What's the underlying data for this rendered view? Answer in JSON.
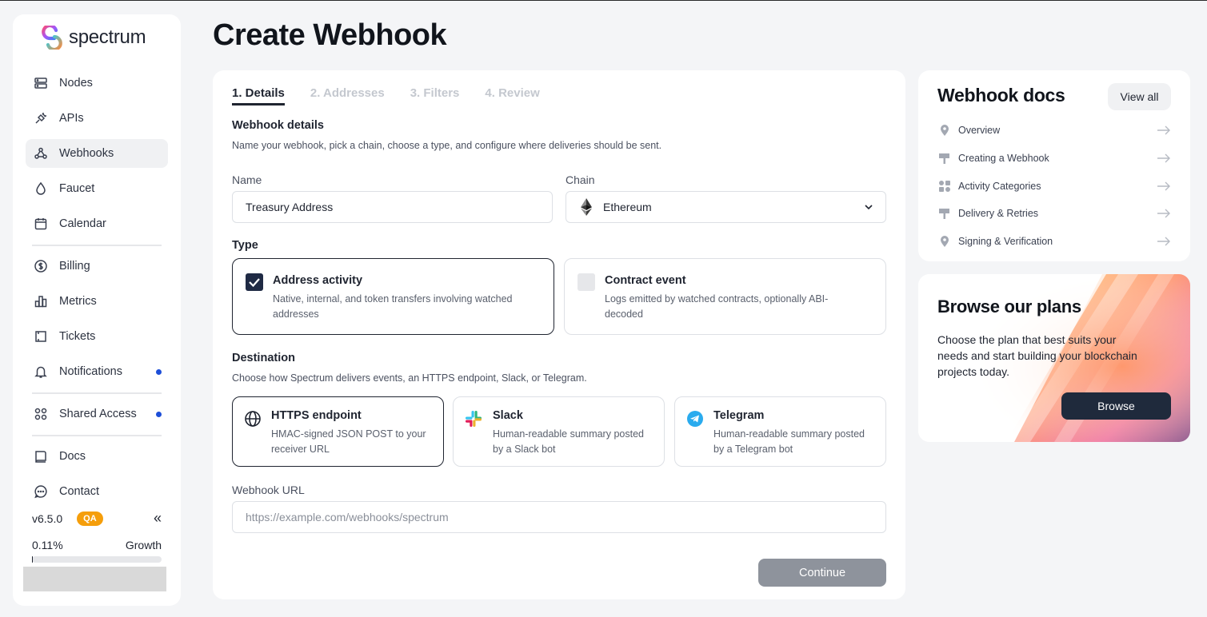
{
  "app": {
    "logo_text": "spectrum"
  },
  "sidebar": {
    "items": [
      {
        "label": "Nodes",
        "icon": "server-icon"
      },
      {
        "label": "APIs",
        "icon": "plug-icon"
      },
      {
        "label": "Webhooks",
        "icon": "webhook-icon",
        "active": true
      },
      {
        "label": "Faucet",
        "icon": "droplet-icon"
      },
      {
        "label": "Calendar",
        "icon": "calendar-icon"
      },
      {
        "label": "Billing",
        "icon": "dollar-icon"
      },
      {
        "label": "Metrics",
        "icon": "bar-chart-icon"
      },
      {
        "label": "Tickets",
        "icon": "ticket-icon"
      },
      {
        "label": "Notifications",
        "icon": "bell-icon",
        "dot": true
      },
      {
        "label": "Shared Access",
        "icon": "grid-circles-icon",
        "dot": true
      },
      {
        "label": "Docs",
        "icon": "book-icon"
      },
      {
        "label": "Contact",
        "icon": "chat-icon"
      }
    ],
    "version": "v6.5.0",
    "env_badge": "QA",
    "collapse_glyph": "«",
    "usage_percent": "0.11%",
    "usage_fraction": 0.0011,
    "plan_label": "Growth"
  },
  "page": {
    "title": "Create Webhook"
  },
  "steps": [
    "1. Details",
    "2. Addresses",
    "3. Filters",
    "4. Review"
  ],
  "details": {
    "title": "Webhook details",
    "subtitle": "Name your webhook, pick a chain, choose a type, and configure where deliveries should be sent.",
    "name_label": "Name",
    "name_value": "Treasury Address",
    "chain_label": "Chain",
    "chain_value": "Ethereum"
  },
  "type": {
    "title": "Type",
    "options": [
      {
        "title": "Address activity",
        "desc": "Native, internal, and token transfers involving watched addresses",
        "selected": true
      },
      {
        "title": "Contract event",
        "desc": "Logs emitted by watched contracts, optionally ABI-decoded",
        "selected": false
      }
    ]
  },
  "destination": {
    "title": "Destination",
    "subtitle": "Choose how Spectrum delivers events, an HTTPS endpoint, Slack, or Telegram.",
    "options": [
      {
        "title": "HTTPS endpoint",
        "desc": "HMAC-signed JSON POST to your receiver URL",
        "icon": "globe-icon",
        "selected": true
      },
      {
        "title": "Slack",
        "desc": "Human-readable summary posted by a Slack bot",
        "icon": "slack-icon",
        "selected": false
      },
      {
        "title": "Telegram",
        "desc": "Human-readable summary posted by a Telegram bot",
        "icon": "telegram-icon",
        "selected": false
      }
    ],
    "url_label": "Webhook URL",
    "url_placeholder": "https://example.com/webhooks/spectrum"
  },
  "actions": {
    "continue": "Continue"
  },
  "docs": {
    "title": "Webhook docs",
    "view_all": "View all",
    "items": [
      "Overview",
      "Creating a Webhook",
      "Activity Categories",
      "Delivery & Retries",
      "Signing & Verification"
    ]
  },
  "plans": {
    "title": "Browse our plans",
    "text": "Choose the plan that best suits your needs and start building your blockchain projects today.",
    "button": "Browse"
  },
  "colors": {
    "accent_dark": "#1f2a44",
    "dot_blue": "#1d4ed8",
    "qa_orange": "#f59e0b",
    "button_disabled": "#8e939c"
  }
}
